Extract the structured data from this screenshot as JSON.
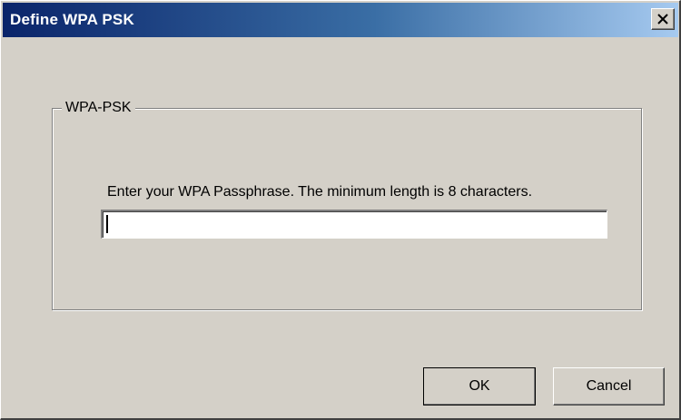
{
  "window": {
    "title": "Define WPA PSK",
    "title_bar_color": "#0a246a",
    "background_color": "#d4d0c8"
  },
  "titlebar": {
    "close_icon": "close-icon"
  },
  "group": {
    "legend": "WPA-PSK"
  },
  "passphrase": {
    "prompt": "Enter your WPA Passphrase.  The minimum length is 8 characters.",
    "value": ""
  },
  "buttons": {
    "ok_label": "OK",
    "cancel_label": "Cancel"
  }
}
